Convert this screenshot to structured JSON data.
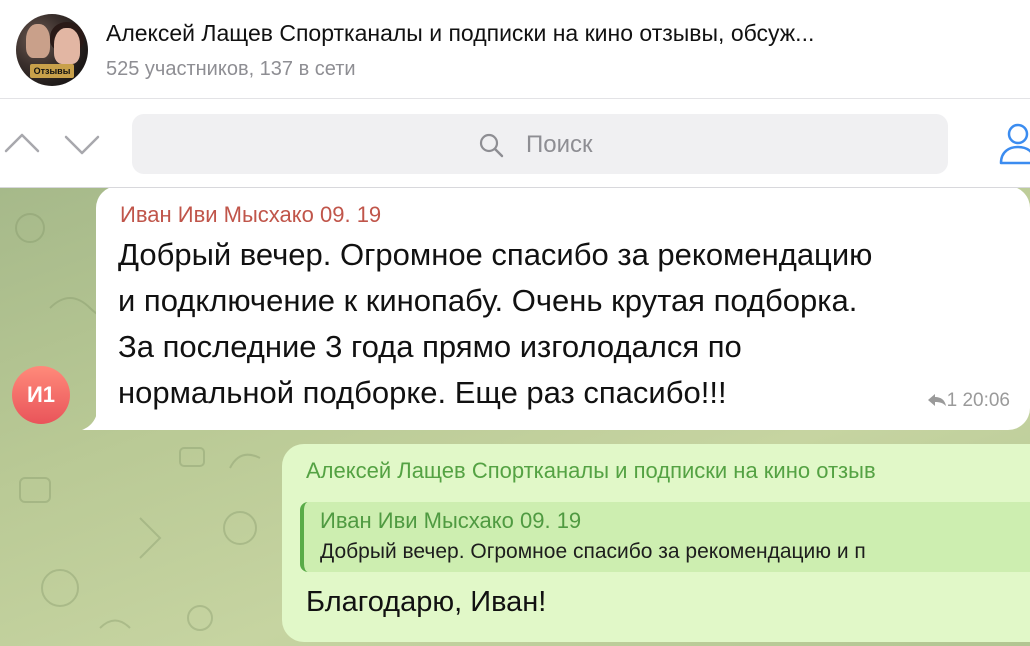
{
  "header": {
    "title": "Алексей Лащев Спортканалы и подписки на кино отзывы, обсуж...",
    "subtitle": "525 участников, 137 в сети",
    "avatar_badge": "Отзывы"
  },
  "search": {
    "placeholder": "Поиск",
    "icons": [
      "chevron-up-icon",
      "chevron-down-icon",
      "search-icon",
      "profile-icon"
    ]
  },
  "messages": {
    "incoming": {
      "avatar_initials": "И1",
      "avatar_color": "#e9545a",
      "sender": "Иван Иви Мысхако 09. 19",
      "sender_color": "#c0554a",
      "lines": [
        "Добрый вечер. Огромное спасибо за рекомендацию",
        "и подключение к кинопабу. Очень крутая подборка.",
        "За последние 3 года прямо изголодался по",
        "нормальной подборке. Еще раз спасибо!!!"
      ],
      "reply_count": "1",
      "time": "20:06"
    },
    "outgoing": {
      "sender": "Алексей Лащев Спортканалы и подписки на кино отзыв",
      "sender_color": "#54a243",
      "quote_name": "Иван Иви Мысхако 09. 19",
      "quote_text": "Добрый вечер. Огромное спасибо за рекомендацию и п",
      "text": "Благодарю, Иван!"
    }
  },
  "colors": {
    "chat_background": "#b9c995",
    "outgoing_bubble": "#e1f8c8",
    "incoming_bubble": "#ffffff"
  }
}
